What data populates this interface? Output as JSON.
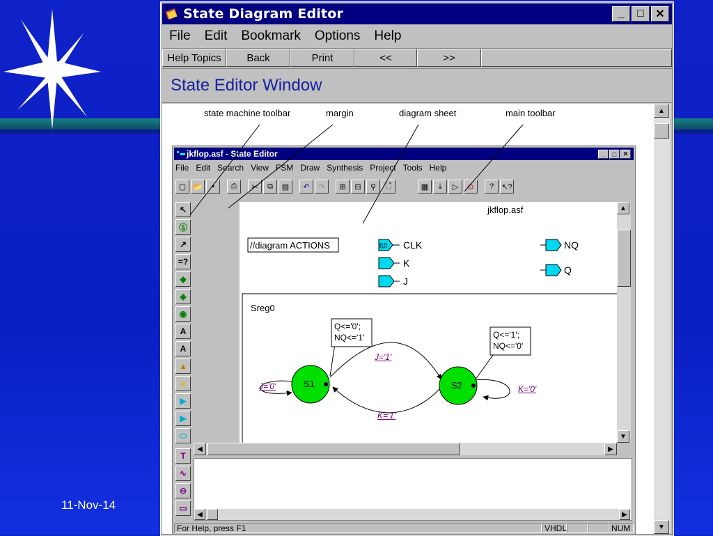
{
  "slide": {
    "date": "11-Nov-14"
  },
  "help_window": {
    "title": "State Diagram Editor",
    "menu": [
      {
        "label": "File"
      },
      {
        "label": "Edit"
      },
      {
        "label": "Bookmark"
      },
      {
        "label": "Options"
      },
      {
        "label": "Help"
      }
    ],
    "buttons": [
      "Help Topics",
      "Back",
      "Print",
      "<<",
      ">>"
    ],
    "header": "State Editor Window",
    "callouts": {
      "state_machine_toolbar": "state machine toolbar",
      "margin": "margin",
      "diagram_sheet": "diagram sheet",
      "main_toolbar": "main toolbar"
    }
  },
  "state_editor": {
    "title": "jkflop.asf - State Editor",
    "menu": [
      "File",
      "Edit",
      "Search",
      "View",
      "FSM",
      "Draw",
      "Synthesis",
      "Project",
      "Tools",
      "Help"
    ],
    "sheet_name": "jkflop.asf",
    "actions_label": "//diagram ACTIONS",
    "ports_in": [
      "CLK",
      "K",
      "J"
    ],
    "ports_out": [
      "NQ",
      "Q"
    ],
    "sreg": "Sreg0",
    "states": [
      {
        "name": "S1",
        "action": "Q<='0';\nNQ<='1'"
      },
      {
        "name": "S2",
        "action": "Q<='1';\nNQ<='0'"
      }
    ],
    "transitions": {
      "s1_self": "J='0'",
      "s1_to_s2": "J='1'",
      "s2_self": "K='0'",
      "s2_to_s1": "K='1'"
    },
    "status": {
      "help": "For Help, press F1",
      "vhdl": "VHDL",
      "num": "NUM"
    },
    "colors": {
      "state_fill": "#00e000",
      "port_fill": "#00d8f0",
      "link": "#800080"
    }
  }
}
